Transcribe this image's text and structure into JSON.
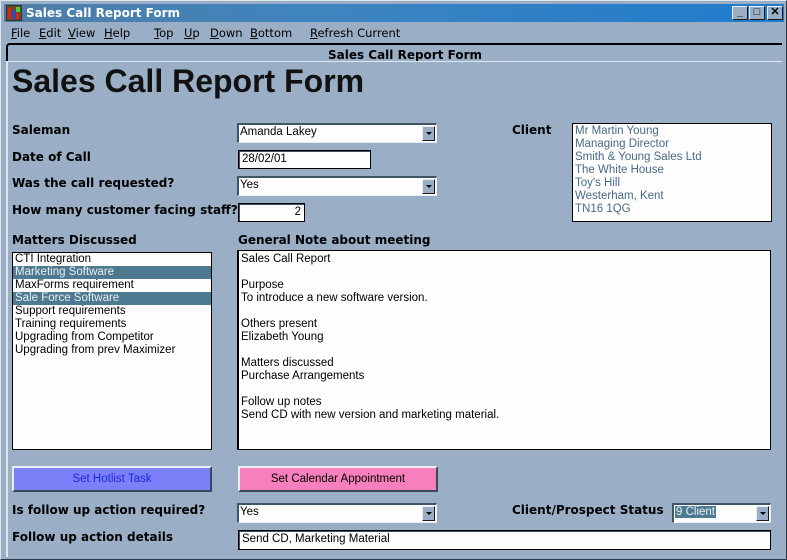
{
  "window": {
    "title": "Sales Call Report Form",
    "controls": {
      "minimize": "_",
      "maximize": "□",
      "close": "✕"
    }
  },
  "menubar": {
    "items": [
      {
        "label": "File",
        "mnemonic": "F"
      },
      {
        "label": "Edit",
        "mnemonic": "E"
      },
      {
        "label": "View",
        "mnemonic": "V"
      },
      {
        "label": "Help",
        "mnemonic": "H"
      },
      {
        "label": "Top",
        "mnemonic": "T"
      },
      {
        "label": "Up",
        "mnemonic": "U"
      },
      {
        "label": "Down",
        "mnemonic": "D"
      },
      {
        "label": "Bottom",
        "mnemonic": "B"
      },
      {
        "label": "Refresh Current",
        "mnemonic": "R"
      }
    ]
  },
  "frame": {
    "tab_title": "Sales Call Report Form"
  },
  "form": {
    "heading": "Sales Call Report Form",
    "saleman": {
      "label": "Saleman",
      "value": "Amanda Lakey"
    },
    "date_of_call": {
      "label": "Date of Call",
      "value": "28/02/01"
    },
    "call_requested": {
      "label": "Was the call requested?",
      "value": "Yes"
    },
    "staff_count": {
      "label": "How many customer facing staff?",
      "value": "2"
    },
    "client": {
      "label": "Client",
      "lines": [
        "Mr Martin Young",
        "Managing Director",
        "Smith & Young Sales Ltd",
        "The White House",
        "Toy's Hill",
        "Westerham, Kent",
        "TN16 1QG"
      ]
    },
    "matters": {
      "label": "Matters Discussed",
      "items": [
        {
          "label": "CTI Integration",
          "selected": false
        },
        {
          "label": "Marketing Software",
          "selected": true
        },
        {
          "label": "MaxForms requirement",
          "selected": false
        },
        {
          "label": "Sale Force Software",
          "selected": true
        },
        {
          "label": "Support requirements",
          "selected": false
        },
        {
          "label": "Training requirements",
          "selected": false
        },
        {
          "label": "Upgrading from Competitor",
          "selected": false
        },
        {
          "label": "Upgrading from prev Maximizer",
          "selected": false
        }
      ]
    },
    "general_note": {
      "label": "General Note about meeting",
      "lines": [
        "Sales Call Report",
        "",
        "Purpose",
        "To introduce a new software version.",
        "",
        "Others present",
        "Elizabeth Young",
        "",
        "Matters discussed",
        "Purchase Arrangements",
        "",
        "Follow up notes",
        "Send CD with new version and marketing material."
      ]
    },
    "buttons": {
      "hotlist": "Set Hotlist Task",
      "calendar": "Set Calendar Appointment"
    },
    "followup_required": {
      "label": "Is follow up action required?",
      "value": "Yes"
    },
    "followup_details": {
      "label": "Follow up action details",
      "value": "Send CD, Marketing Material"
    },
    "status": {
      "label": "Client/Prospect Status",
      "value": "9 Client"
    }
  },
  "colors": {
    "background": "#9aafc6",
    "selection": "#4e7a91",
    "hotlist_button": "#7b7ff8",
    "hotlist_text": "#1c2ae0",
    "calendar_button": "#f77fbd",
    "client_text": "#4a6a86"
  }
}
